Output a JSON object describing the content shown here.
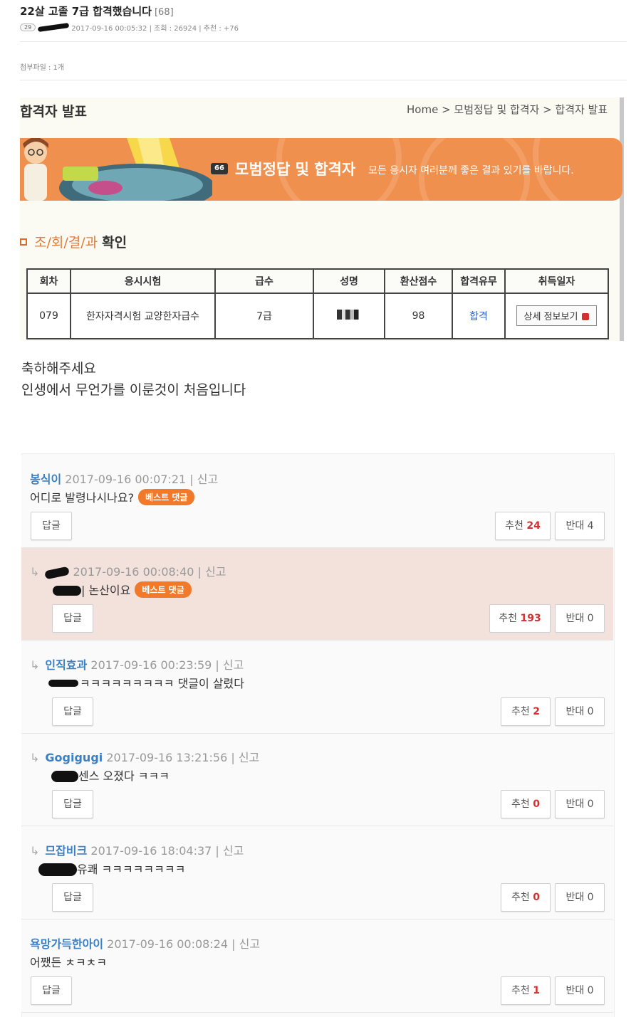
{
  "post": {
    "title": "22살 고졸 7급 합격했습니다",
    "comment_count": "[68]",
    "level": "29",
    "meta": "2017-09-16 00:05:32 | 조회 : 26924 | 추천 : +76",
    "attachments": "첨부파일 : 1개"
  },
  "embed": {
    "title": "합격자 발표",
    "breadcrumb": "Home > 모범정답 및 합격자 > 합격자 발표",
    "banner_quote": "66",
    "banner_heading": "모범정답 및 합격자",
    "banner_sub": "모든 응시자 여러분께 좋은 결과 있기를 바랍니다.",
    "section_prefix": "조/회/결/과",
    "section_bold": "확인",
    "table": {
      "headers": [
        "회차",
        "응시시험",
        "급수",
        "성명",
        "환산점수",
        "합격유무",
        "취득일자"
      ],
      "row": {
        "round": "079",
        "exam": "한자자격시험 교양한자급수",
        "grade": "7급",
        "score": "98",
        "result": "합격",
        "detail_button": "상세 정보보기"
      }
    }
  },
  "body": {
    "line1": "축하해주세요",
    "line2": "인생에서 무언가를 이룬것이 처음입니다"
  },
  "comments": [
    {
      "nick": "봉식이",
      "meta": " 2017-09-16 00:07:21 | 신고",
      "text": "어디로 발령나시나요?",
      "best": "베스트 댓글",
      "reply": "답글",
      "up_label": "추천",
      "up": "24",
      "down": "반대 4"
    },
    {
      "nick": "",
      "meta": " 2017-09-16 00:08:40 | 신고",
      "text": "| 논산이요",
      "best": "베스트 댓글",
      "reply": "답글",
      "up_label": "추천",
      "up": "193",
      "down": "반대 0"
    },
    {
      "nick": "인직효과",
      "meta": " 2017-09-16 00:23:59 | 신고",
      "text": "ㅋㅋㅋㅋㅋㅋㅋㅋㅋ 댓글이 살렸다",
      "reply": "답글",
      "up_label": "추천",
      "up": "2",
      "down": "반대 0"
    },
    {
      "nick": "Gogigugi",
      "meta": " 2017-09-16 13:21:56 | 신고",
      "text": "센스 오졌다 ㅋㅋㅋ",
      "reply": "답글",
      "up_label": "추천",
      "up": "0",
      "down": "반대 0"
    },
    {
      "nick": "므잡비크",
      "meta": " 2017-09-16 18:04:37 | 신고",
      "text": "유쾌 ㅋㅋㅋㅋㅋㅋㅋㅋ",
      "reply": "답글",
      "up_label": "추천",
      "up": "0",
      "down": "반대 0"
    },
    {
      "nick": "욕망가득한아이",
      "meta": " 2017-09-16 00:08:24 | 신고",
      "text": "어쨌든 ㅊㅋㅊㅋ",
      "reply": "답글",
      "up_label": "추천",
      "up": "1",
      "down": "반대 0"
    }
  ],
  "icons": {
    "reply_arrow": "reply-arrow-icon",
    "quote": "quote-icon",
    "section_bullet": "square-bullet-icon"
  },
  "colors": {
    "banner": "#f0904e",
    "nick": "#3b7fc4",
    "best_badge": "#f07a2a",
    "recommend_count": "#d62f2f",
    "pass": "#2a67c9",
    "highlight_row": "#f3e1dc"
  }
}
